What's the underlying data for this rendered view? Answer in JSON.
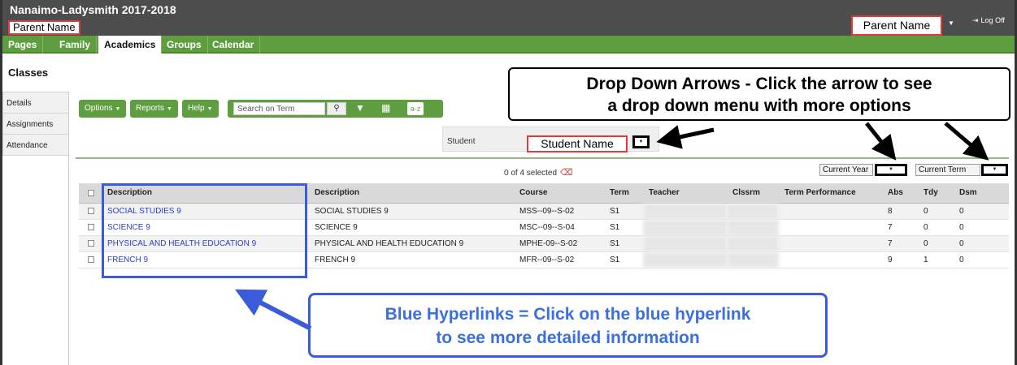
{
  "header": {
    "school": "Nanaimo-Ladysmith 2017-2018",
    "user_left": "Parent Name",
    "user_right": "Parent Name",
    "logoff": "Log Off"
  },
  "nav": {
    "tabs": [
      {
        "label": "Pages"
      },
      {
        "label": "Family"
      },
      {
        "label": "Academics"
      },
      {
        "label": "Groups"
      },
      {
        "label": "Calendar"
      }
    ]
  },
  "page_title": "Classes",
  "sidebar": {
    "items": [
      {
        "label": "Details"
      },
      {
        "label": "Assignments"
      },
      {
        "label": "Attendance"
      }
    ]
  },
  "toolbar": {
    "options": "Options",
    "reports": "Reports",
    "help": "Help",
    "search_placeholder": "Search on Term",
    "az": "a-z"
  },
  "student": {
    "label": "Student",
    "value": "Student Name"
  },
  "selection": {
    "count_text": "0 of 4 selected"
  },
  "filters": {
    "year": "Current Year",
    "term": "Current Term"
  },
  "table": {
    "headers": [
      "Description",
      "Description",
      "Course",
      "Term",
      "Teacher",
      "Clssrm",
      "Term Performance",
      "Abs",
      "Tdy",
      "Dsm"
    ],
    "rows": [
      {
        "link": "SOCIAL STUDIES 9",
        "desc": "SOCIAL STUDIES 9",
        "course": "MSS--09--S-02",
        "term": "S1",
        "abs": "8",
        "tdy": "0",
        "dsm": "0"
      },
      {
        "link": "SCIENCE 9",
        "desc": "SCIENCE 9",
        "course": "MSC--09--S-04",
        "term": "S1",
        "abs": "7",
        "tdy": "0",
        "dsm": "0"
      },
      {
        "link": "PHYSICAL AND HEALTH EDUCATION 9",
        "desc": "PHYSICAL AND HEALTH EDUCATION 9",
        "course": "MPHE-09--S-02",
        "term": "S1",
        "abs": "7",
        "tdy": "0",
        "dsm": "0"
      },
      {
        "link": "FRENCH 9",
        "desc": "FRENCH 9",
        "course": "MFR--09--S-02",
        "term": "S1",
        "abs": "9",
        "tdy": "1",
        "dsm": "0"
      }
    ]
  },
  "annotations": {
    "top_line1": "Drop Down Arrows - Click the arrow to see",
    "top_line2": "a drop down menu with more options",
    "bottom_line1": "Blue Hyperlinks = Click on the blue hyperlink",
    "bottom_line2": "to see more detailed information"
  },
  "colors": {
    "nav_green": "#5f9e40",
    "header_gray": "#4d4d4d",
    "link_blue": "#2a3fcc",
    "annotation_red": "#e03a3a",
    "annotation_blue": "#3b5bdb"
  }
}
